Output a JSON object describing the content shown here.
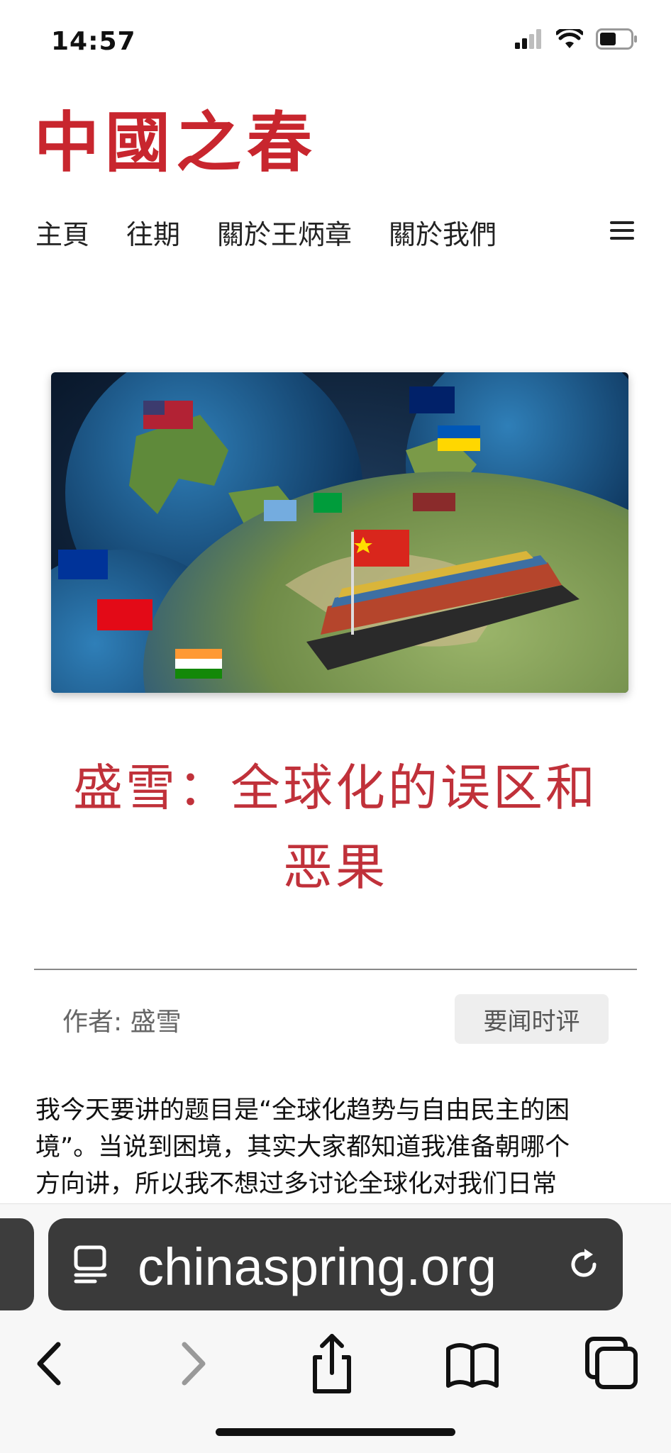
{
  "status_bar": {
    "time": "14:57"
  },
  "site": {
    "logo_text": "中國之春"
  },
  "nav": {
    "items": [
      "主頁",
      "往期",
      "關於王炳章",
      "關於我們"
    ]
  },
  "article": {
    "title_line1": "盛雪：全球化的误区和",
    "title_line2": "恶果",
    "author": "作者: 盛雪",
    "category": "要闻时评",
    "body_lines": [
      "我今天要讲的题目是“全球化趋势与自由民主的困",
      "境”。当说到困境，其实大家都知道我准备朝哪个",
      "方向讲，所以我不想过多讨论全球化对我们日常"
    ]
  },
  "browser": {
    "url": "chinaspring.org"
  },
  "colors": {
    "accent": "#c8262e",
    "title": "#c0313a",
    "url_bar": "#3a3a3a"
  },
  "icons": [
    "signal-icon",
    "wifi-icon",
    "battery-icon",
    "menu-icon",
    "reader-icon",
    "reload-icon",
    "back-icon",
    "forward-icon",
    "share-icon",
    "bookmarks-icon",
    "tabs-icon"
  ]
}
